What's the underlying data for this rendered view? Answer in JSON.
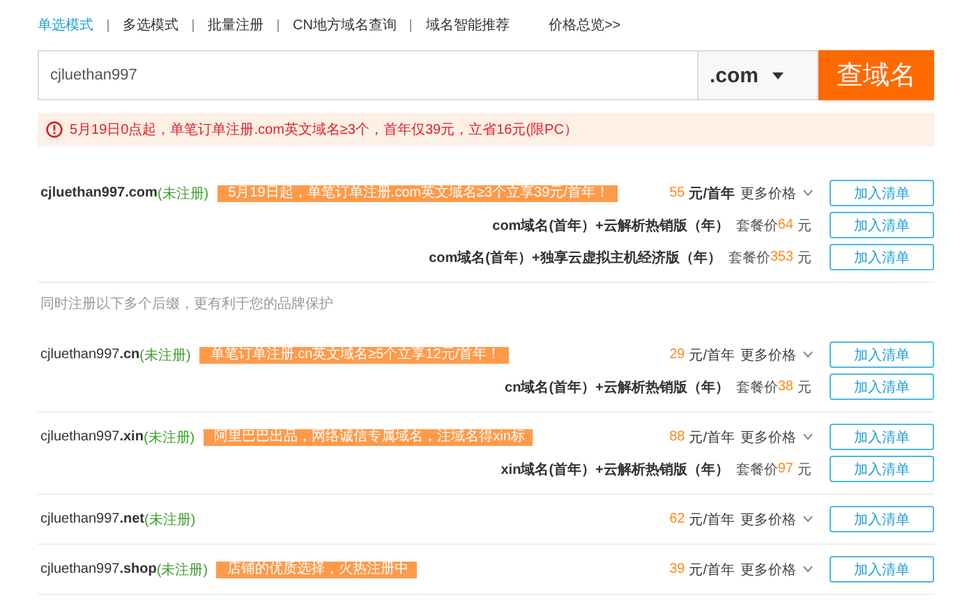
{
  "tabs": [
    {
      "label": "单选模式",
      "selected": true
    },
    {
      "label": "多选模式",
      "selected": false
    },
    {
      "label": "批量注册",
      "selected": false
    },
    {
      "label": "CN地方域名查询",
      "selected": false
    },
    {
      "label": "域名智能推荐",
      "selected": false
    }
  ],
  "price_link": "价格总览>>",
  "search": {
    "value": "cjluethan997",
    "suffix": ".com",
    "button": "查域名"
  },
  "notice": "5月19日0点起，单笔订单注册.com英文域名≥3个，首年仅39元，立省16元(限PC）",
  "subtitle": "同时注册以下多个后缀，更有利于您的品牌保护",
  "results": [
    {
      "featured": true,
      "name": "cjluethan997",
      "tld": ".com",
      "status": "(未注册)",
      "promo": "5月19日起，单笔订单注册.com英文域名≥3个立享39元/首年！",
      "price": "55",
      "unit": "元/首年",
      "more": "更多价格",
      "button": "加入清单",
      "bundles": [
        {
          "label": "com域名(首年）+云解析热销版（年）",
          "prefix": "套餐价",
          "price": "64",
          "unit": "元",
          "button": "加入清单"
        },
        {
          "label": "com域名(首年）+独享云虚拟主机经济版（年）",
          "prefix": "套餐价",
          "price": "353",
          "unit": "元",
          "button": "加入清单"
        }
      ]
    },
    {
      "featured": false,
      "name": "cjluethan997",
      "tld": ".cn",
      "status": "(未注册)",
      "promo": "单笔订单注册.cn英文域名≥5个立享12元/首年！",
      "price": "29",
      "unit": "元/首年",
      "more": "更多价格",
      "button": "加入清单",
      "bundles": [
        {
          "label": "cn域名(首年）+云解析热销版（年）",
          "prefix": "套餐价",
          "price": "38",
          "unit": "元",
          "button": "加入清单"
        }
      ]
    },
    {
      "featured": false,
      "name": "cjluethan997",
      "tld": ".xin",
      "status": "(未注册)",
      "promo": "阿里巴巴出品，网络诚信专属域名，注域名得xin标",
      "price": "88",
      "unit": "元/首年",
      "more": "更多价格",
      "button": "加入清单",
      "bundles": [
        {
          "label": "xin域名(首年）+云解析热销版（年）",
          "prefix": "套餐价",
          "price": "97",
          "unit": "元",
          "button": "加入清单"
        }
      ]
    },
    {
      "featured": false,
      "name": "cjluethan997",
      "tld": ".net",
      "status": "(未注册)",
      "price": "62",
      "unit": "元/首年",
      "more": "更多价格",
      "button": "加入清单"
    },
    {
      "featured": false,
      "name": "cjluethan997",
      "tld": ".shop",
      "status": "(未注册)",
      "promo": "店铺的优质选择，火热注册中",
      "price": "39",
      "unit": "元/首年",
      "more": "更多价格",
      "button": "加入清单"
    }
  ]
}
